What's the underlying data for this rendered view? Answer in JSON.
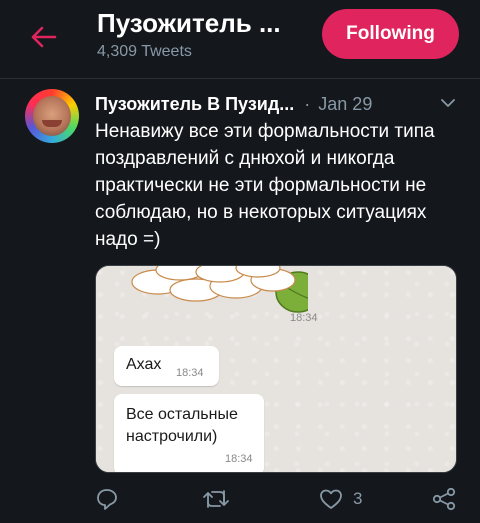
{
  "header": {
    "title": "Пузожитель ...",
    "tweet_count": "4,309 Tweets",
    "follow_label": "Following"
  },
  "tweet": {
    "author": "Пузожитель В Пузид...",
    "separator": "·",
    "date": "Jan 29",
    "text": "Ненавижу все эти формальности типа поздравлений с днюхой и никогда практически не эти формальности не соблюдаю, но в некоторых ситуациях надо =)"
  },
  "media": {
    "sticker_time": "18:34",
    "messages": [
      {
        "text": "Ахах",
        "time": "18:34"
      },
      {
        "text": "Все остальные настрочили)",
        "time": "18:34"
      }
    ]
  },
  "actions": {
    "like_count": "3"
  },
  "colors": {
    "background": "#14171c",
    "accent": "#e0245e",
    "muted": "#8899a6",
    "back_arrow": "#e0245e"
  },
  "icons": [
    "back-arrow-icon",
    "chevron-down-icon",
    "reply-icon",
    "retweet-icon",
    "like-icon",
    "share-icon"
  ]
}
